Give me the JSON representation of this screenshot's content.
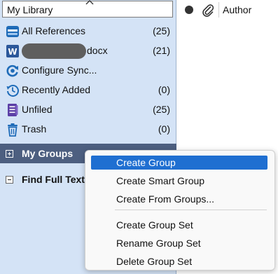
{
  "library_selector": {
    "value": "My Library"
  },
  "collections": [
    {
      "label": "All References",
      "count": "(25)",
      "icon": "folder-references-icon"
    },
    {
      "label": "docx",
      "count": "(21)",
      "icon": "word-document-icon",
      "redacted": true
    },
    {
      "label": "Configure Sync...",
      "count": "",
      "icon": "sync-icon"
    },
    {
      "label": "Recently Added",
      "count": "(0)",
      "icon": "history-icon"
    },
    {
      "label": "Unfiled",
      "count": "(25)",
      "icon": "unfiled-icon"
    },
    {
      "label": "Trash",
      "count": "(0)",
      "icon": "trash-icon"
    }
  ],
  "groups": {
    "my_groups": "My Groups",
    "find_full_text": "Find Full Text"
  },
  "columns": {
    "author": "Author"
  },
  "context_menu": {
    "items": [
      {
        "label": "Create Group",
        "selected": true
      },
      {
        "label": "Create Smart Group"
      },
      {
        "label": "Create From Groups..."
      },
      {
        "label": "Create Group Set"
      },
      {
        "label": "Rename Group Set"
      },
      {
        "label": "Delete Group Set"
      }
    ]
  },
  "colors": {
    "sidebar_bg": "#d4e3f6",
    "selected_group_bg": "#4d5f80",
    "menu_highlight": "#1f6fd1",
    "icon_blue": "#1e6bb8",
    "word_blue": "#2b579a",
    "unfiled_purple": "#5b3fa6"
  }
}
